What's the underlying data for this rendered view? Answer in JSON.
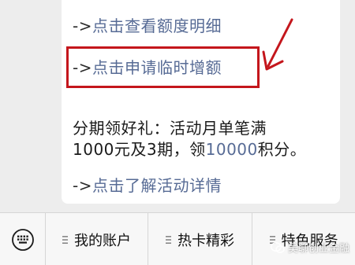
{
  "message": {
    "line1": {
      "prefix": "->",
      "link": "点击查看额度明细"
    },
    "line2": {
      "prefix": "->",
      "link": "点击申请临时增额"
    },
    "promo_line1": "分期领好礼：活动月单笔满",
    "promo_line2_pre": "1000元及3期，领",
    "promo_points": "10000",
    "promo_line2_post": "积分。",
    "line3": {
      "prefix": "->",
      "link": "点击了解活动详情"
    }
  },
  "menu": {
    "keyboard_icon": "keyboard-icon",
    "items": [
      {
        "label": "我的账户",
        "icon": "menu-lines-icon"
      },
      {
        "label": "热卡精彩",
        "icon": "menu-lines-icon"
      },
      {
        "label": "特色服务",
        "icon": "menu-lines-icon"
      }
    ]
  },
  "watermark": {
    "text": "吴聊创业金融",
    "icon": "chat-bubble-icon"
  },
  "colors": {
    "link": "#576b95",
    "highlight": "#c4161c",
    "background": "#ededed",
    "bubble": "#ffffff"
  }
}
